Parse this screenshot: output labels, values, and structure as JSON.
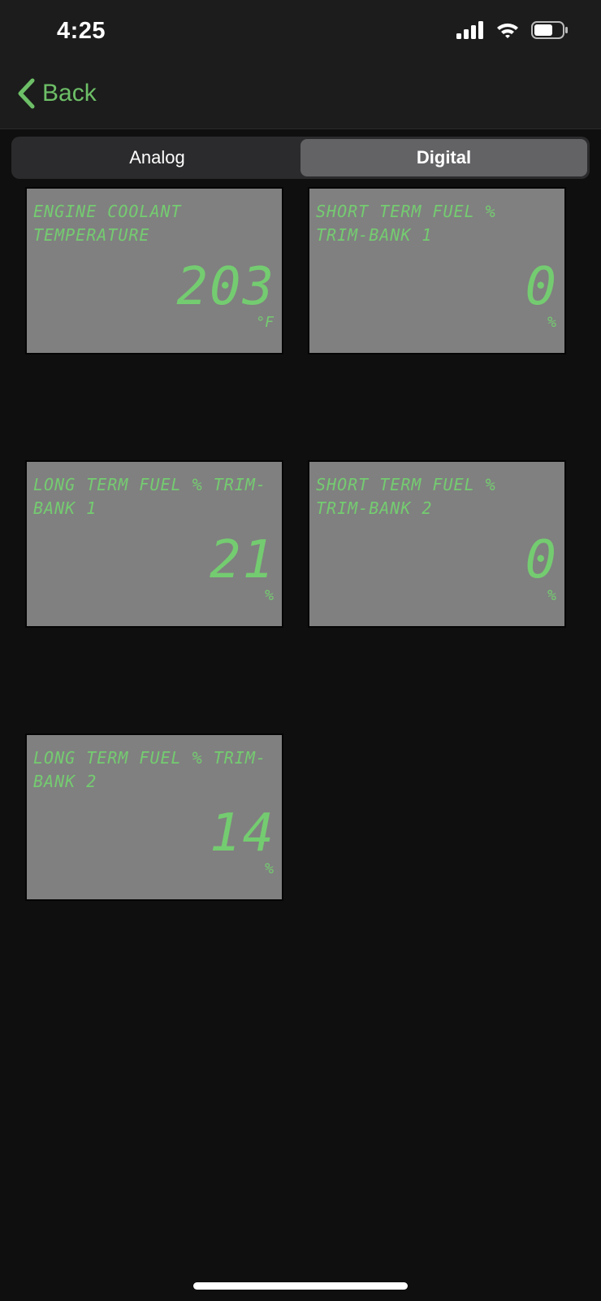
{
  "status_bar": {
    "time": "4:25",
    "icons": [
      "signal-icon",
      "wifi-icon",
      "battery-icon"
    ]
  },
  "nav": {
    "back_label": "Back"
  },
  "segmented": {
    "options": [
      "Analog",
      "Digital"
    ],
    "selected": "Digital"
  },
  "gauges": [
    {
      "label": "ENGINE COOLANT TEMPERATURE",
      "value": "203",
      "unit": "°F"
    },
    {
      "label": "SHORT TERM FUEL % TRIM-BANK 1",
      "value": "0",
      "unit": "%"
    },
    {
      "label": "LONG TERM FUEL % TRIM-BANK 1",
      "value": "21",
      "unit": "%"
    },
    {
      "label": "SHORT TERM FUEL % TRIM-BANK 2",
      "value": "0",
      "unit": "%"
    },
    {
      "label": "LONG TERM FUEL % TRIM-BANK 2",
      "value": "14",
      "unit": "%"
    }
  ],
  "colors": {
    "accent": "#6dbf67",
    "lcd_text": "#74cc70",
    "tile_bg": "#808080",
    "background": "#0f0f0f"
  }
}
